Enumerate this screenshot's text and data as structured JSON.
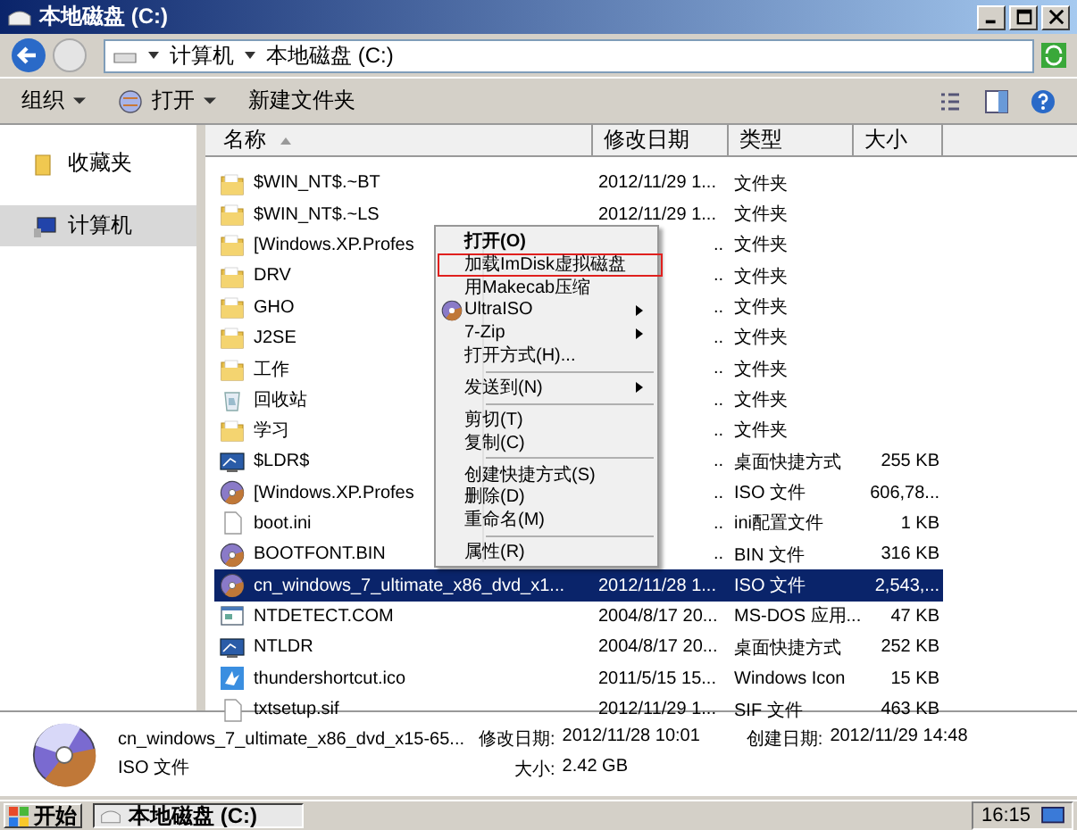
{
  "window": {
    "title": "本地磁盘 (C:)"
  },
  "address": {
    "crumbs": [
      "计算机",
      "本地磁盘 (C:)"
    ]
  },
  "toolbar": {
    "items": [
      {
        "label": "组织",
        "kind": "dropdown"
      },
      {
        "label": "打开",
        "kind": "open"
      },
      {
        "label": "新建文件夹",
        "kind": "plain"
      }
    ]
  },
  "sidebar": {
    "items": [
      {
        "label": "收藏夹",
        "kind": "folder",
        "selected": false
      },
      {
        "label": "计算机",
        "kind": "computer",
        "selected": true
      }
    ]
  },
  "table": {
    "columns": [
      "名称",
      "修改日期",
      "类型",
      "大小"
    ],
    "rows": [
      {
        "name": "$WIN_NT$.~BT",
        "kind": "folder",
        "date": "2012/11/29 1...",
        "type": "文件夹",
        "size": "",
        "selected": false
      },
      {
        "name": "$WIN_NT$.~LS",
        "kind": "folder",
        "date": "2012/11/29 1...",
        "type": "文件夹",
        "size": "",
        "selected": false
      },
      {
        "name": "[Windows.XP.Profes",
        "kind": "folder",
        "date": "..",
        "type": "文件夹",
        "size": "",
        "selected": false
      },
      {
        "name": "DRV",
        "kind": "folder",
        "date": "..",
        "type": "文件夹",
        "size": "",
        "selected": false
      },
      {
        "name": "GHO",
        "kind": "folder",
        "date": "..",
        "type": "文件夹",
        "size": "",
        "selected": false
      },
      {
        "name": "J2SE",
        "kind": "folder",
        "date": "..",
        "type": "文件夹",
        "size": "",
        "selected": false
      },
      {
        "name": "工作",
        "kind": "folder",
        "date": "..",
        "type": "文件夹",
        "size": "",
        "selected": false
      },
      {
        "name": "回收站",
        "kind": "recycle",
        "date": "..",
        "type": "文件夹",
        "size": "",
        "selected": false
      },
      {
        "name": "学习",
        "kind": "folder",
        "date": "..",
        "type": "文件夹",
        "size": "",
        "selected": false
      },
      {
        "name": "$LDR$",
        "kind": "shortcut",
        "date": "..",
        "type": "桌面快捷方式",
        "size": "255 KB",
        "selected": false
      },
      {
        "name": "[Windows.XP.Profes",
        "kind": "disc",
        "date": "..",
        "type": "ISO 文件",
        "size": "606,78...",
        "selected": false
      },
      {
        "name": "boot.ini",
        "kind": "text",
        "date": "..",
        "type": "ini配置文件",
        "size": "1 KB",
        "selected": false
      },
      {
        "name": "BOOTFONT.BIN",
        "kind": "disc",
        "date": "..",
        "type": "BIN 文件",
        "size": "316 KB",
        "selected": false
      },
      {
        "name": "cn_windows_7_ultimate_x86_dvd_x1...",
        "kind": "disc",
        "date": "2012/11/28 1...",
        "type": "ISO 文件",
        "size": "2,543,...",
        "selected": true
      },
      {
        "name": "NTDETECT.COM",
        "kind": "app",
        "date": "2004/8/17 20...",
        "type": "MS-DOS 应用...",
        "size": "47 KB",
        "selected": false
      },
      {
        "name": "NTLDR",
        "kind": "shortcut",
        "date": "2004/8/17 20...",
        "type": "桌面快捷方式",
        "size": "252 KB",
        "selected": false
      },
      {
        "name": "thundershortcut.ico",
        "kind": "ico",
        "date": "2011/5/15 15...",
        "type": "Windows Icon",
        "size": "15 KB",
        "selected": false
      },
      {
        "name": "txtsetup.sif",
        "kind": "text",
        "date": "2012/11/29 1...",
        "type": "SIF 文件",
        "size": "463 KB",
        "selected": false
      }
    ]
  },
  "context_menu": {
    "items": [
      {
        "kind": "item",
        "label": "打开(O)",
        "bold": true,
        "highlighted": false,
        "submenu": false,
        "has_icon": false
      },
      {
        "kind": "item",
        "label": "加载ImDisk虚拟磁盘",
        "bold": false,
        "highlighted": true,
        "submenu": false,
        "has_icon": false
      },
      {
        "kind": "item",
        "label": "用Makecab压缩",
        "bold": false,
        "highlighted": false,
        "submenu": false,
        "has_icon": false
      },
      {
        "kind": "item",
        "label": "UltraISO",
        "bold": false,
        "highlighted": false,
        "submenu": true,
        "has_icon": true
      },
      {
        "kind": "item",
        "label": "7-Zip",
        "bold": false,
        "highlighted": false,
        "submenu": true,
        "has_icon": false
      },
      {
        "kind": "item",
        "label": "打开方式(H)...",
        "bold": false,
        "highlighted": false,
        "submenu": false,
        "has_icon": false
      },
      {
        "kind": "separator"
      },
      {
        "kind": "item",
        "label": "发送到(N)",
        "bold": false,
        "highlighted": false,
        "submenu": true,
        "has_icon": false
      },
      {
        "kind": "separator"
      },
      {
        "kind": "item",
        "label": "剪切(T)",
        "bold": false,
        "highlighted": false,
        "submenu": false,
        "has_icon": false
      },
      {
        "kind": "item",
        "label": "复制(C)",
        "bold": false,
        "highlighted": false,
        "submenu": false,
        "has_icon": false
      },
      {
        "kind": "separator"
      },
      {
        "kind": "item",
        "label": "创建快捷方式(S)",
        "bold": false,
        "highlighted": false,
        "submenu": false,
        "has_icon": false
      },
      {
        "kind": "item",
        "label": "删除(D)",
        "bold": false,
        "highlighted": false,
        "submenu": false,
        "has_icon": false
      },
      {
        "kind": "item",
        "label": "重命名(M)",
        "bold": false,
        "highlighted": false,
        "submenu": false,
        "has_icon": false
      },
      {
        "kind": "separator"
      },
      {
        "kind": "item",
        "label": "属性(R)",
        "bold": false,
        "highlighted": false,
        "submenu": false,
        "has_icon": false
      }
    ]
  },
  "details": {
    "name": "cn_windows_7_ultimate_x86_dvd_x15-65...",
    "type": "ISO 文件",
    "fields": [
      {
        "label": "修改日期:",
        "value": "2012/11/28 10:01"
      },
      {
        "label": "创建日期:",
        "value": "2012/11/29 14:48"
      },
      {
        "label": "大小:",
        "value": "2.42 GB"
      }
    ]
  },
  "taskbar": {
    "start": "开始",
    "tasks": [
      {
        "label": "本地磁盘 (C:)",
        "selected": true
      }
    ],
    "clock": "16:15"
  }
}
